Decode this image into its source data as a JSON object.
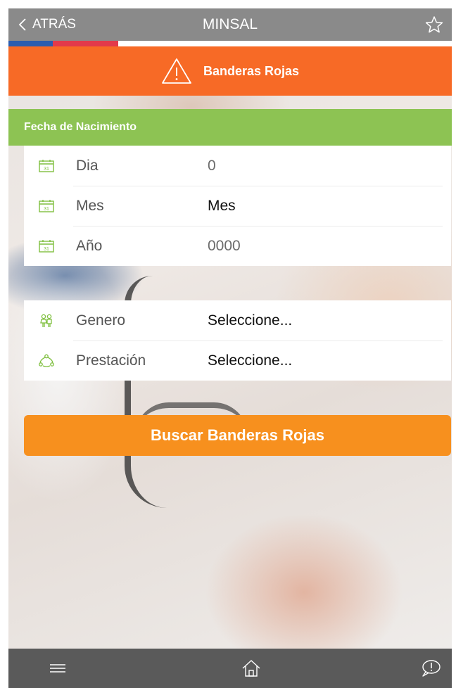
{
  "header": {
    "back_label": "ATRÁS",
    "title": "MINSAL",
    "icons": {
      "back": "chevron-left-icon",
      "favorite": "star-outline-icon"
    },
    "flag_colors": [
      "#2a5db0",
      "#e23a4b",
      "#ffffff"
    ]
  },
  "banner": {
    "icon": "warning-icon",
    "title": "Banderas Rojas",
    "color": "#f76a26"
  },
  "birth_section": {
    "title": "Fecha de Nacimiento",
    "color": "#8dc353",
    "rows": [
      {
        "icon": "calendar-icon",
        "label": "Dia",
        "value": "0"
      },
      {
        "icon": "calendar-icon",
        "label": "Mes",
        "value": "Mes"
      },
      {
        "icon": "calendar-icon",
        "label": "Año",
        "value": "0000"
      }
    ]
  },
  "details_section": {
    "rows": [
      {
        "icon": "gender-icon",
        "label": "Genero",
        "value": "Seleccione..."
      },
      {
        "icon": "service-network-icon",
        "label": "Prestación",
        "value": "Seleccione..."
      }
    ]
  },
  "search_button": {
    "label": "Buscar Banderas Rojas",
    "color": "#f7901e"
  },
  "bottom_nav": {
    "items": [
      {
        "icon": "menu-icon"
      },
      {
        "icon": "home-icon"
      },
      {
        "icon": "chat-alert-icon"
      }
    ]
  }
}
